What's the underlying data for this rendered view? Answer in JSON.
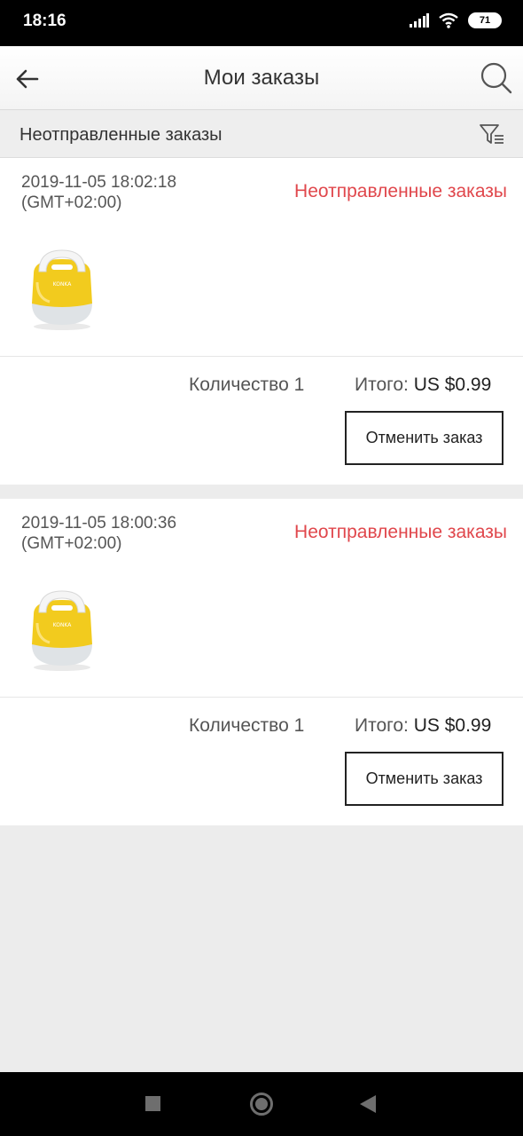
{
  "status_bar": {
    "time": "18:16",
    "battery": "71",
    "icons": [
      "signal-icon",
      "wifi-icon",
      "battery-icon"
    ]
  },
  "header": {
    "title": "Мои заказы",
    "icons": [
      "back-arrow-icon",
      "search-icon"
    ]
  },
  "filter": {
    "label": "Неотправленные заказы",
    "icon": "filter-icon"
  },
  "orders": [
    {
      "date": "2019-11-05 18:02:18",
      "timezone": "(GMT+02:00)",
      "status": "Неотправленные заказы",
      "quantity": "Количество 1",
      "total_label": "Итого:",
      "total_value": "US $0.99",
      "cancel_label": "Отменить заказ"
    },
    {
      "date": "2019-11-05 18:00:36",
      "timezone": "(GMT+02:00)",
      "status": "Неотправленные заказы",
      "quantity": "Количество 1",
      "total_label": "Итого:",
      "total_value": "US $0.99",
      "cancel_label": "Отменить заказ"
    }
  ],
  "product_image_brand": "KONKA",
  "colors": {
    "status_red": "#e0474c",
    "product_yellow": "#f2cb1e"
  },
  "nav_bar": {
    "icons": [
      "recents-square-icon",
      "home-circle-icon",
      "back-triangle-icon"
    ]
  }
}
